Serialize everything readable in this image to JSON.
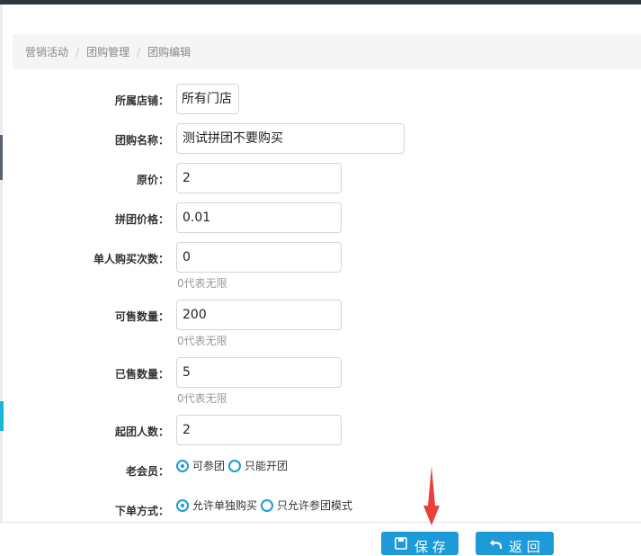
{
  "breadcrumb": [
    "营销活动",
    "团购管理",
    "团购编辑"
  ],
  "form": {
    "store": {
      "label": "所属店铺：",
      "value": "所有门店"
    },
    "name": {
      "label": "团购名称：",
      "value": "测试拼团不要购买"
    },
    "original_price": {
      "label": "原价：",
      "value": "2"
    },
    "group_price": {
      "label": "拼团价格：",
      "value": "0.01"
    },
    "buy_times": {
      "label": "单人购买次数：",
      "value": "0",
      "hint": "0代表无限"
    },
    "sale_quantity": {
      "label": "可售数量：",
      "value": "200",
      "hint": "0代表无限"
    },
    "sold_quantity": {
      "label": "已售数量：",
      "value": "5",
      "hint": "0代表无限"
    },
    "min_group": {
      "label": "起团人数：",
      "value": "2"
    },
    "old_member": {
      "label": "老会员：",
      "options": [
        "可参团",
        "只能开团"
      ],
      "selected": "可参团"
    },
    "order_mode": {
      "label": "下单方式：",
      "options": [
        "允许单独购买",
        "只允许参团模式"
      ],
      "selected": "允许单独购买"
    }
  },
  "footer": {
    "save_label": "保 存",
    "back_label": "返 回"
  },
  "colors": {
    "accent": "#1c9bd8",
    "annotation_arrow": "#e8403a"
  }
}
